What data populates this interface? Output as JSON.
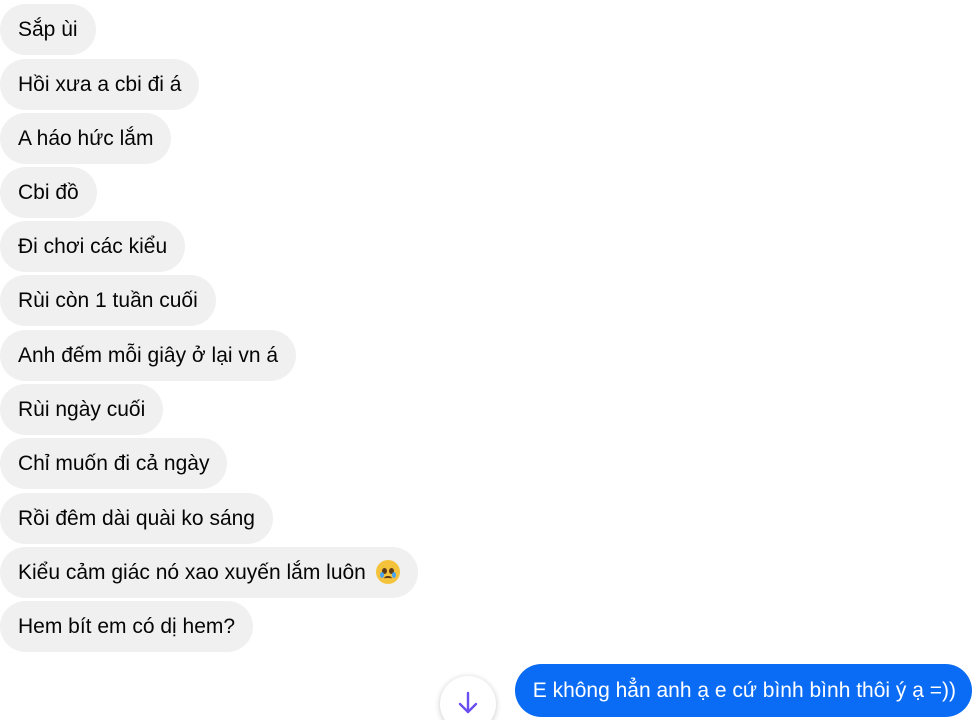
{
  "conversation": {
    "incoming": [
      "Sắp ùi",
      "Hồi xưa a cbi đi á",
      "A háo hức lắm",
      "Cbi đồ",
      "Đi chơi các kiểu",
      "Rùi còn 1 tuần cuối",
      "Anh đếm mỗi giây ở lại vn á",
      "Rùi ngày cuối",
      "Chỉ muốn đi cả ngày",
      "Rồi đêm dài quài ko sáng",
      "Kiểu cảm giác nó xao xuyến lắm luôn",
      "Hem bít em có dị hem?"
    ],
    "incoming_emoji": "crying-face-emoji",
    "outgoing": [
      "E không hẳn anh ạ e cứ bình bình thôi ý ạ =))"
    ]
  },
  "icons": {
    "scroll_down": "arrow-down-icon"
  },
  "colors": {
    "incoming_bubble": "#f0f0f0",
    "outgoing_bubble": "#0a6cf5",
    "arrow": "#6b4ef0"
  }
}
